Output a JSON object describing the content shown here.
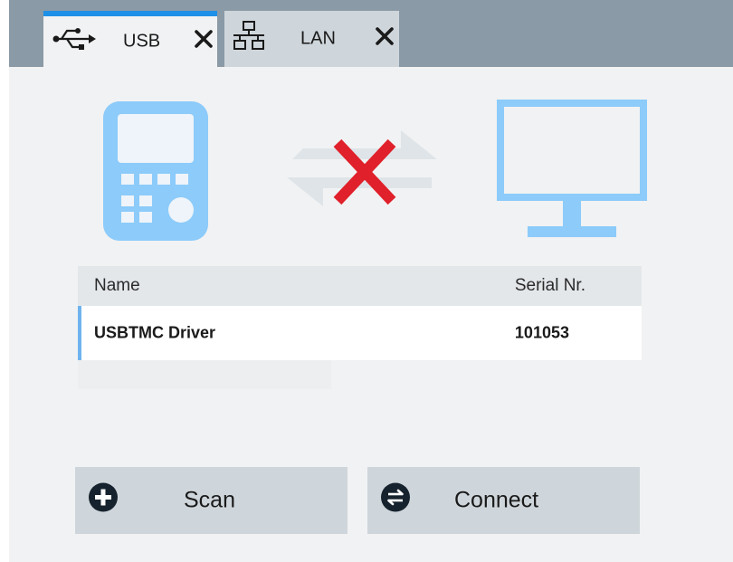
{
  "tabs": [
    {
      "label": "USB",
      "icon": "usb-icon",
      "active": true
    },
    {
      "label": "LAN",
      "icon": "network-icon",
      "active": false
    }
  ],
  "colors": {
    "accent": "#1e90e8",
    "illustration": "#8ccbfa",
    "error_x": "#e0202a"
  },
  "connection": {
    "device_icon": "handheld-device-icon",
    "link_icon": "disconnected-arrows-icon",
    "pc_icon": "monitor-icon"
  },
  "table": {
    "headers": {
      "name": "Name",
      "serial": "Serial Nr."
    },
    "rows": [
      {
        "name": "USBTMC Driver",
        "serial": "101053"
      }
    ]
  },
  "buttons": {
    "scan": {
      "label": "Scan",
      "icon": "plus-circle-icon"
    },
    "connect": {
      "label": "Connect",
      "icon": "exchange-circle-icon"
    }
  }
}
